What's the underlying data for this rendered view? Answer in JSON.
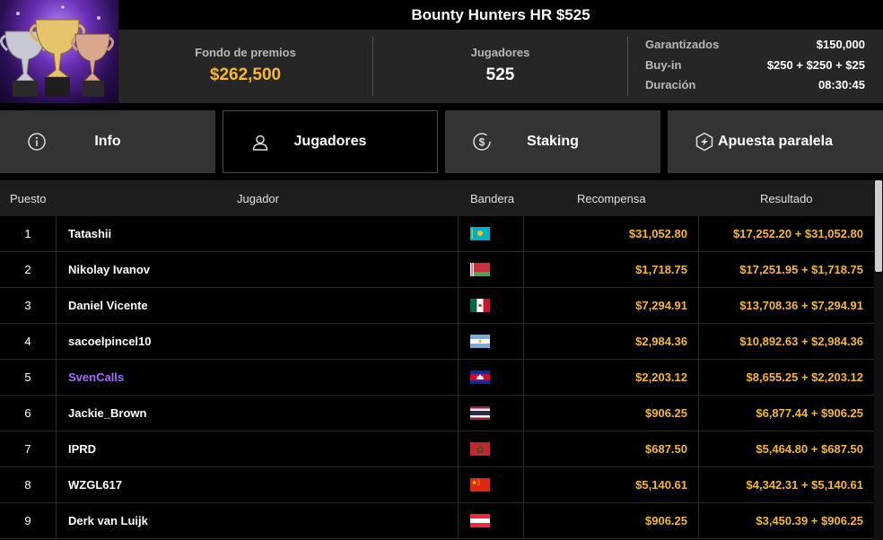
{
  "title": "Bounty Hunters HR $525",
  "stats": {
    "prize_pool_label": "Fondo de premios",
    "prize_pool_value": "$262,500",
    "players_label": "Jugadores",
    "players_value": "525",
    "details": [
      {
        "label": "Garantizados",
        "value": "$150,000"
      },
      {
        "label": "Buy-in",
        "value": "$250 + $250 + $25"
      },
      {
        "label": "Duración",
        "value": "08:30:45"
      }
    ]
  },
  "tabs": [
    {
      "label": "Info",
      "icon": "info-icon"
    },
    {
      "label": "Jugadores",
      "icon": "user-icon",
      "active": true
    },
    {
      "label": "Staking",
      "icon": "dollar-coin-icon"
    },
    {
      "label": "Apuesta paralela",
      "icon": "lightning-hexagon-icon"
    }
  ],
  "table": {
    "headers": {
      "pos": "Puesto",
      "player": "Jugador",
      "flag": "Bandera",
      "reward": "Recompensa",
      "result": "Resultado"
    },
    "rows": [
      {
        "pos": "1",
        "name": "Tatashii",
        "flag": "kazakhstan",
        "reward": "$31,052.80",
        "result": "$17,252.20 + $31,052.80"
      },
      {
        "pos": "2",
        "name": "Nikolay Ivanov",
        "flag": "belarus",
        "reward": "$1,718.75",
        "result": "$17,251.95 + $1,718.75"
      },
      {
        "pos": "3",
        "name": "Daniel Vicente",
        "flag": "mexico",
        "reward": "$7,294.91",
        "result": "$13,708.36 + $7,294.91"
      },
      {
        "pos": "4",
        "name": "sacoelpincel10",
        "flag": "argentina",
        "reward": "$2,984.36",
        "result": "$10,892.63 + $2,984.36"
      },
      {
        "pos": "5",
        "name": "SvenCalls",
        "flag": "cambodia",
        "reward": "$2,203.12",
        "result": "$8,655.25 + $2,203.12",
        "highlight": true
      },
      {
        "pos": "6",
        "name": "Jackie_Brown",
        "flag": "thailand",
        "reward": "$906.25",
        "result": "$6,877.44 + $906.25"
      },
      {
        "pos": "7",
        "name": "IPRD",
        "flag": "morocco",
        "reward": "$687.50",
        "result": "$5,464.80 + $687.50"
      },
      {
        "pos": "8",
        "name": "WZGL617",
        "flag": "china",
        "reward": "$5,140.61",
        "result": "$4,342.31 + $5,140.61"
      },
      {
        "pos": "9",
        "name": "Derk van Luijk",
        "flag": "austria",
        "reward": "$906.25",
        "result": "$3,450.39 + $906.25"
      }
    ]
  },
  "colors": {
    "accent_gold": "#f5b82e",
    "highlight_player": "#a46bff",
    "panel": "#262626",
    "tab": "#333333"
  }
}
